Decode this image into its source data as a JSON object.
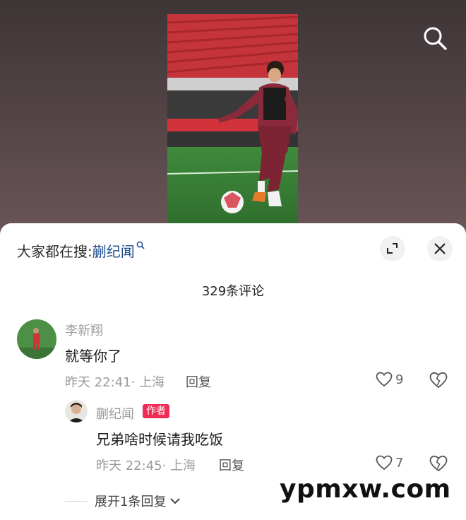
{
  "search_hint": {
    "prefix": "大家都在搜:",
    "keyword": "蒯纪闻"
  },
  "comments_count": "329条评论",
  "comments": [
    {
      "username": "李新翔",
      "text": "就等你了",
      "time": "昨天 22:41",
      "location": "上海",
      "reply_label": "回复",
      "likes": "9"
    }
  ],
  "reply": {
    "username": "蒯纪闻",
    "badge": "作者",
    "text": "兄弟啥时候请我吃饭",
    "time": "昨天 22:45",
    "location": "上海",
    "reply_label": "回复",
    "likes": "7"
  },
  "expand_label": "展开1条回复",
  "watermark": "ypmxw.com",
  "icons": [
    "search-icon",
    "fullscreen-icon",
    "close-icon",
    "heart-icon",
    "broken-heart-icon",
    "chevron-down-icon"
  ],
  "colors": {
    "keyword": "#1f4f8f",
    "author_badge": "#ee2d56",
    "jersey": "#8b2a3a"
  }
}
